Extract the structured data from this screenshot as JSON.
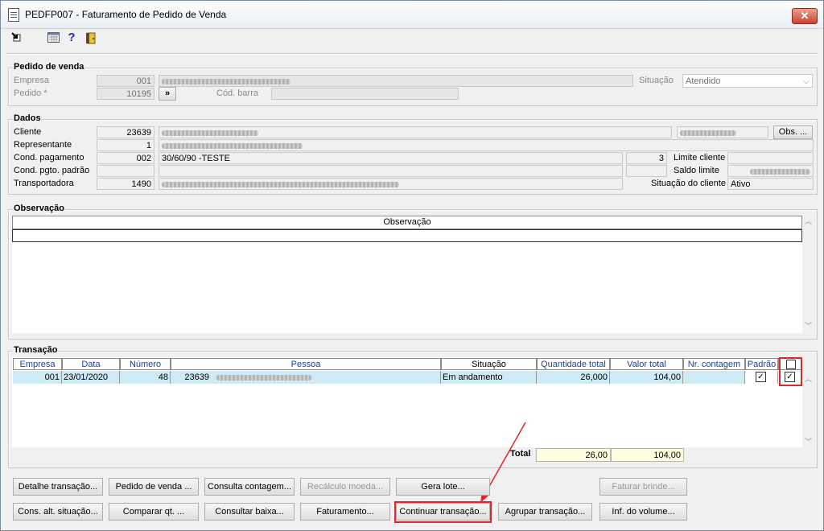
{
  "window": {
    "title": "PEDFP007 - Faturamento de Pedido de Venda",
    "close": "✕"
  },
  "toolbar": {
    "icons": [
      "exit-arrow-icon",
      "calendar-icon",
      "help-icon",
      "door-exit-icon"
    ],
    "help_glyph": "?"
  },
  "pedido": {
    "section_title": "Pedido de venda",
    "empresa_label": "Empresa",
    "empresa_value": "001",
    "pedido_label": "Pedido *",
    "pedido_value": "10195",
    "jump_label": "»",
    "cod_barra_label": "Cód. barra",
    "cod_barra_value": "",
    "situacao_label": "Situação",
    "situacao_value": "Atendido"
  },
  "dados": {
    "section_title": "Dados",
    "cliente_label": "Cliente",
    "cliente_code": "23639",
    "obs_button": "Obs. ...",
    "representante_label": "Representante",
    "representante_code": "1",
    "cond_pagamento_label": "Cond. pagamento",
    "cond_pagamento_code": "002",
    "cond_pagamento_desc": "30/60/90 -TESTE",
    "cond_pagamento_qty": "3",
    "cond_pgto_padrao_label": "Cond. pgto. padrão",
    "transportadora_label": "Transportadora",
    "transportadora_code": "1490",
    "limite_cliente_label": "Limite cliente",
    "saldo_limite_label": "Saldo limite",
    "situacao_cliente_label": "Situação do cliente",
    "situacao_cliente_value": "Ativo"
  },
  "observacao": {
    "section_title": "Observação",
    "column": "Observação"
  },
  "transacao": {
    "section_title": "Transação",
    "columns": [
      "Empresa",
      "Data",
      "Número",
      "Pessoa",
      "Situação",
      "Quantidade total",
      "Valor total",
      "Nr. contagem",
      "Padrão"
    ],
    "rows": [
      {
        "empresa": "001",
        "data": "23/01/2020",
        "numero": "48",
        "pessoa_code": "23639",
        "situacao": "Em andamento",
        "quantidade_total": "26,000",
        "valor_total": "104,00",
        "nr_contagem": "",
        "padrao": true,
        "selected": true
      }
    ],
    "total_label": "Total",
    "total_quantidade": "26,00",
    "total_valor": "104,00"
  },
  "buttons": {
    "detalhe_transacao": "Detalhe transação...",
    "pedido_de_venda": "Pedido de venda ...",
    "consulta_contagem": "Consulta contagem...",
    "recalculo_moeda": "Recálculo moeda...",
    "gera_lote": "Gera lote...",
    "faturar_brinde": "Faturar brinde...",
    "cons_alt_situacao": "Cons. alt. situação...",
    "comparar_qt": "Comparar qt. ...",
    "consultar_baixa": "Consultar baixa...",
    "faturamento": "Faturamento...",
    "continuar_transacao": "Continuar transação...",
    "agrupar_transacao": "Agrupar transação...",
    "inf_do_volume": "Inf. do volume..."
  },
  "colors": {
    "highlight": "#e0262b",
    "selected_row": "#cdeaf5",
    "total_field": "#fffde0",
    "header_text": "#1a3fa8"
  }
}
